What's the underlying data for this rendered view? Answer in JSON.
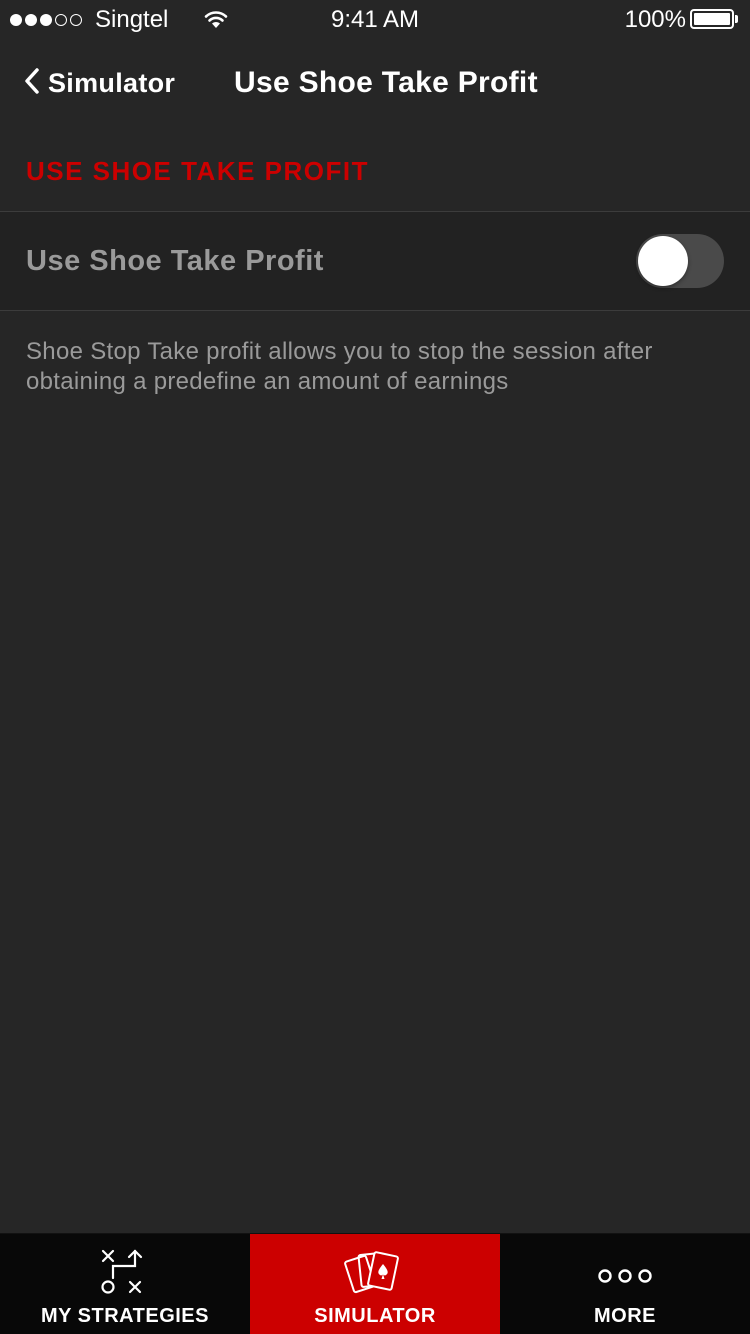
{
  "status_bar": {
    "carrier": "Singtel",
    "time": "9:41 AM",
    "battery": "100%",
    "signal_bars_filled": 3,
    "signal_bars_total": 5
  },
  "nav": {
    "back_label": "Simulator",
    "title": "Use Shoe Take Profit"
  },
  "section": {
    "header": "USE SHOE TAKE PROFIT"
  },
  "setting": {
    "label": "Use Shoe Take Profit",
    "enabled": false
  },
  "description": "Shoe Stop Take profit allows you to stop the session after obtaining a predefine an amount of earnings",
  "tabs": [
    {
      "label": "MY STRATEGIES",
      "icon": "strategy-icon",
      "active": false
    },
    {
      "label": "SIMULATOR",
      "icon": "cards-icon",
      "active": true
    },
    {
      "label": "MORE",
      "icon": "more-icon",
      "active": false
    }
  ],
  "colors": {
    "accent": "#cc0000",
    "background": "#262626",
    "tab_bar": "#080808"
  }
}
